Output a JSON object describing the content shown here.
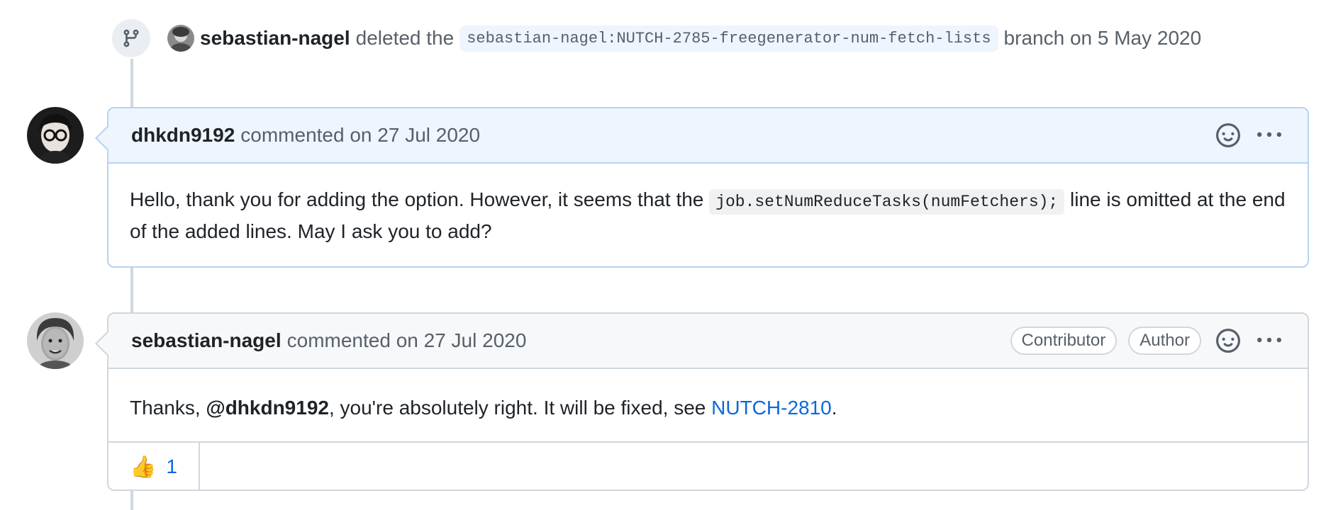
{
  "event": {
    "author": "sebastian-nagel",
    "verb": "deleted the",
    "branch": "sebastian-nagel:NUTCH-2785-freegenerator-num-fetch-lists",
    "suffix": "branch on 5 May 2020",
    "icon": "git-branch-icon"
  },
  "comments": [
    {
      "author": "dhkdn9192",
      "meta": "commented on 27 Jul 2020",
      "body_before_code": "Hello, thank you for adding the option. However, it seems that the ",
      "code": "job.setNumReduceTasks(numFetchers);",
      "body_after_code": " line is omitted at the end of the added lines. May I ask you to add?"
    },
    {
      "author": "sebastian-nagel",
      "meta": "commented on 27 Jul 2020",
      "labels": [
        "Contributor",
        "Author"
      ],
      "body_prefix": "Thanks, ",
      "mention": "@dhkdn9192",
      "body_middle": ", you're absolutely right. It will be fixed, see ",
      "link": "NUTCH-2810",
      "body_suffix": ".",
      "reaction": {
        "emoji": "👍",
        "count": "1"
      }
    }
  ],
  "colors": {
    "accent": "#0969da",
    "highlight_bg": "#eef5fc",
    "border": "#d0d7de"
  }
}
